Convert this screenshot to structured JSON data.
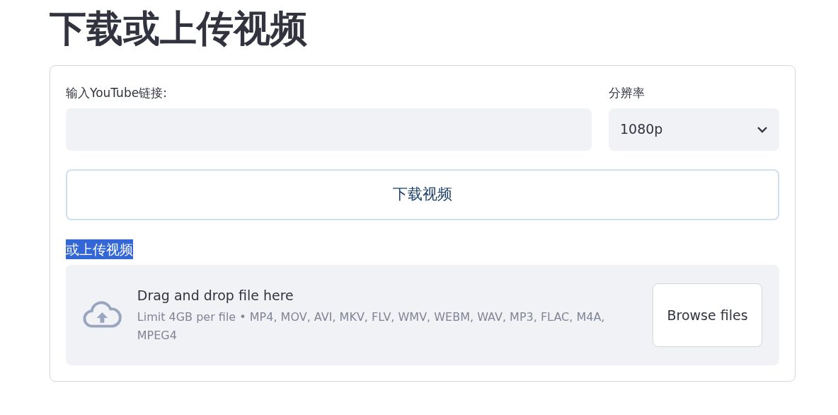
{
  "title": "下载或上传视频",
  "url_field": {
    "label": "输入YouTube链接:"
  },
  "resolution": {
    "label": "分辨率",
    "value": "1080p"
  },
  "download_button": {
    "label": "下载视频",
    "focused": true
  },
  "upload": {
    "label": "或上传视频",
    "highlighted": true,
    "dropzone": {
      "heading": "Drag and drop file here",
      "hint": "Limit 4GB per file • MP4, MOV, AVI, MKV, FLV, WMV, WEBM, WAV, MP3, FLAC, M4A, MPEG4"
    },
    "browse_button": "Browse files"
  }
}
